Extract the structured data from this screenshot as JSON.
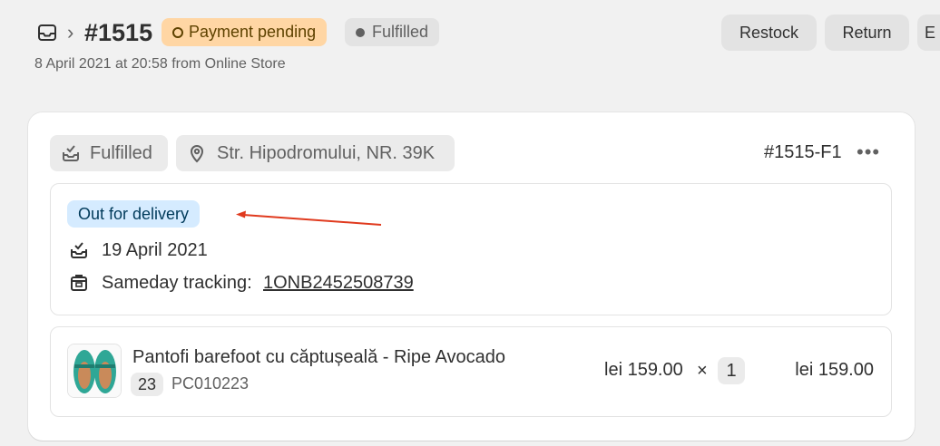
{
  "header": {
    "order_number": "#1515",
    "payment_badge": "Payment pending",
    "fulfillment_badge": "Fulfilled",
    "subtitle": "8 April 2021 at 20:58 from Online Store",
    "buttons": {
      "restock": "Restock",
      "return": "Return",
      "more": "E"
    }
  },
  "fulfillment": {
    "status_chip": "Fulfilled",
    "address_chip": "Str. Hipodromului, NR. 39K",
    "fulfillment_id": "#1515-F1",
    "more_actions": "•••",
    "tracking": {
      "status_badge": "Out for delivery",
      "date": "19 April 2021",
      "tracking_label": "Sameday tracking:",
      "tracking_number": "1ONB2452508739"
    },
    "line_item": {
      "name": "Pantofi barefoot cu căptușeală - Ripe Avocado",
      "size": "23",
      "sku": "PC010223",
      "unit_price": "lei 159.00",
      "times": "×",
      "quantity": "1",
      "total": "lei 159.00"
    }
  },
  "colors": {
    "payment_badge_bg": "#ffd6a4",
    "out_for_delivery_bg": "#d5ebff",
    "annotation_arrow": "#e03a1e"
  }
}
